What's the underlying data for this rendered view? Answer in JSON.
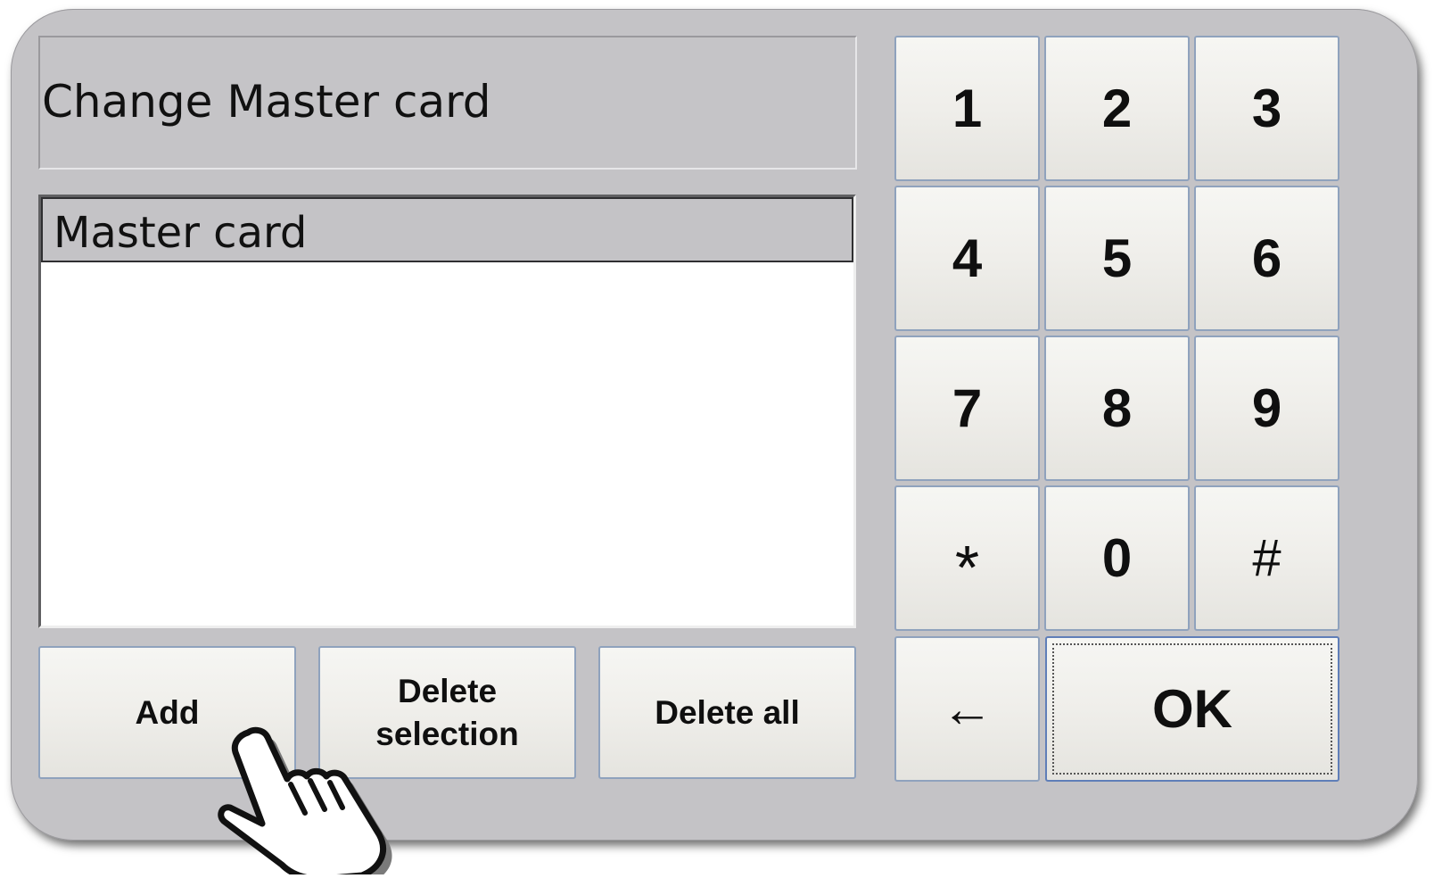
{
  "dialog": {
    "title": "Change Master card"
  },
  "list": {
    "header": "Master card",
    "items": []
  },
  "actions": {
    "add": "Add",
    "delete_selection_line1": "Delete",
    "delete_selection_line2": "selection",
    "delete_all": "Delete all"
  },
  "keypad": {
    "k1": "1",
    "k2": "2",
    "k3": "3",
    "k4": "4",
    "k5": "5",
    "k6": "6",
    "k7": "7",
    "k8": "8",
    "k9": "9",
    "kstar": "*",
    "k0": "0",
    "khash": "#",
    "backspace": "←",
    "ok": "OK"
  },
  "icons": {
    "pointer": "hand-pointer-icon"
  },
  "colors": {
    "panel_bg": "#c4c3c6",
    "button_border": "#8fa2bd",
    "ok_border": "#5f7eb8",
    "list_bg": "#ffffff"
  }
}
